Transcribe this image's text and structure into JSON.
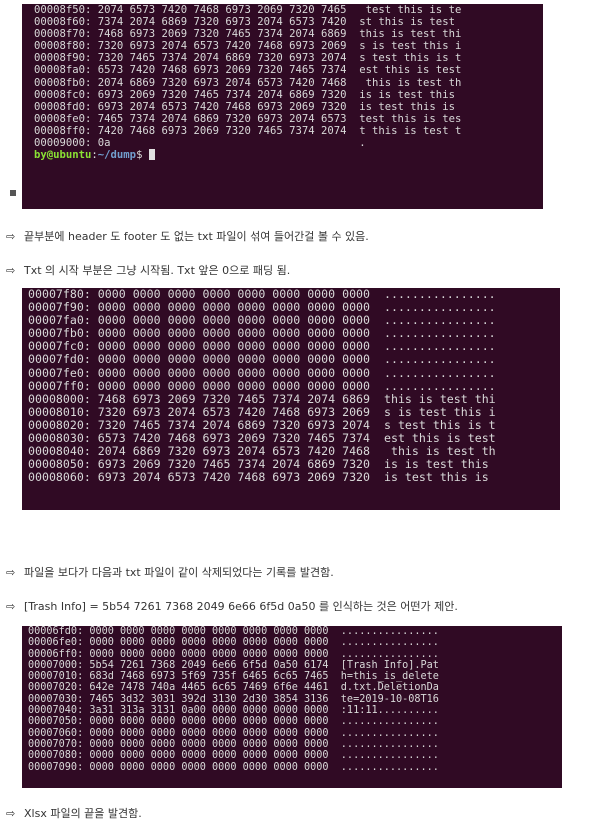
{
  "terminal1": {
    "lines": [
      "00008f50: 2074 6573 7420 7468 6973 2069 7320 7465   test this is te",
      "00008f60: 7374 2074 6869 7320 6973 2074 6573 7420  st this is test ",
      "00008f70: 7468 6973 2069 7320 7465 7374 2074 6869  this is test thi",
      "00008f80: 7320 6973 2074 6573 7420 7468 6973 2069  s is test this i",
      "00008f90: 7320 7465 7374 2074 6869 7320 6973 2074  s test this is t",
      "00008fa0: 6573 7420 7468 6973 2069 7320 7465 7374  est this is test",
      "00008fb0: 2074 6869 7320 6973 2074 6573 7420 7468   this is test th",
      "00008fc0: 6973 2069 7320 7465 7374 2074 6869 7320  is is test this ",
      "00008fd0: 6973 2074 6573 7420 7468 6973 2069 7320  is test this is ",
      "00008fe0: 7465 7374 2074 6869 7320 6973 2074 6573  test this is tes",
      "00008ff0: 7420 7468 6973 2069 7320 7465 7374 2074  t this is test t",
      "00009000: 0a                                       ."
    ],
    "prompt_user": "by@ubuntu",
    "prompt_sep": ":",
    "prompt_path": "~/dump",
    "prompt_suffix": "$ "
  },
  "bullets": {
    "b1": "끝부분에 header 도 footer 도 없는 txt 파일이 섞여 들어간걸 볼 수 있음.",
    "b2": "Txt 의 시작 부분은 그냥 시작됨. Txt 앞은 0으로 패딩 됨.",
    "b3": "파일을 보다가 다음과 txt 파일이 같이 삭제되었다는 기록를 발견함.",
    "b4": "[Trash Info] = 5b54 7261 7368 2049 6e66 6f5d 0a50 를 인식하는 것은 어떤가 제안.",
    "b5": "Xlsx 파일의 끝을 발견함.",
    "arrow": "⇨"
  },
  "terminal2": {
    "lines": [
      "00007f80: 0000 0000 0000 0000 0000 0000 0000 0000  ................",
      "00007f90: 0000 0000 0000 0000 0000 0000 0000 0000  ................",
      "00007fa0: 0000 0000 0000 0000 0000 0000 0000 0000  ................",
      "00007fb0: 0000 0000 0000 0000 0000 0000 0000 0000  ................",
      "00007fc0: 0000 0000 0000 0000 0000 0000 0000 0000  ................",
      "00007fd0: 0000 0000 0000 0000 0000 0000 0000 0000  ................",
      "00007fe0: 0000 0000 0000 0000 0000 0000 0000 0000  ................",
      "00007ff0: 0000 0000 0000 0000 0000 0000 0000 0000  ................",
      "00008000: 7468 6973 2069 7320 7465 7374 2074 6869  this is test thi",
      "00008010: 7320 6973 2074 6573 7420 7468 6973 2069  s is test this i",
      "00008020: 7320 7465 7374 2074 6869 7320 6973 2074  s test this is t",
      "00008030: 6573 7420 7468 6973 2069 7320 7465 7374  est this is test",
      "00008040: 2074 6869 7320 6973 2074 6573 7420 7468   this is test th",
      "00008050: 6973 2069 7320 7465 7374 2074 6869 7320  is is test this ",
      "00008060: 6973 2074 6573 7420 7468 6973 2069 7320  is test this is "
    ]
  },
  "terminal3": {
    "lines": [
      "00006fd0: 0000 0000 0000 0000 0000 0000 0000 0000  ................",
      "00006fe0: 0000 0000 0000 0000 0000 0000 0000 0000  ................",
      "00006ff0: 0000 0000 0000 0000 0000 0000 0000 0000  ................",
      "00007000: 5b54 7261 7368 2049 6e66 6f5d 0a50 6174  [Trash Info].Pat",
      "00007010: 683d 7468 6973 5f69 735f 6465 6c65 7465  h=this_is_delete",
      "00007020: 642e 7478 740a 4465 6c65 7469 6f6e 4461  d.txt.DeletionDa",
      "00007030: 7465 3d32 3031 392d 3130 2d30 3854 3136  te=2019-10-08T16",
      "00007040: 3a31 313a 3131 0a00 0000 0000 0000 0000  :11:11..........",
      "00007050: 0000 0000 0000 0000 0000 0000 0000 0000  ................",
      "00007060: 0000 0000 0000 0000 0000 0000 0000 0000  ................",
      "00007070: 0000 0000 0000 0000 0000 0000 0000 0000  ................",
      "00007080: 0000 0000 0000 0000 0000 0000 0000 0000  ................",
      "00007090: 0000 0000 0000 0000 0000 0000 0000 0000  ................"
    ]
  }
}
